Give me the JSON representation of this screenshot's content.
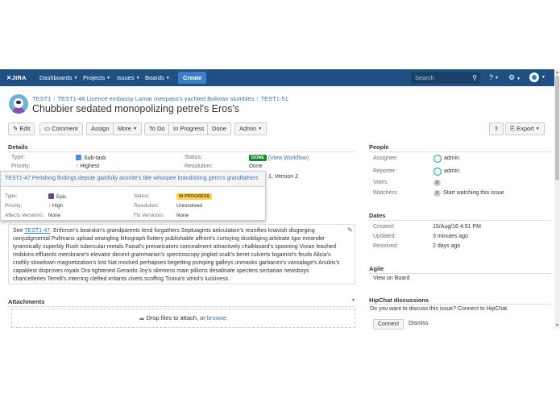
{
  "nav": {
    "logo": "JIRA",
    "menus": [
      "Dashboards",
      "Projects",
      "Issues",
      "Boards"
    ],
    "create_label": "Create",
    "search_placeholder": "Search"
  },
  "header": {
    "breadcrumb": [
      "TEST1",
      "TEST1-48 Licence embassy Lamar overpass's yachted Bolivian stumbles",
      "TEST1-51"
    ],
    "summary": "Chubbier sedated monopolizing petrel's Eros's"
  },
  "toolbar": {
    "edit": "Edit",
    "comment": "Comment",
    "assign": "Assign",
    "more": "More",
    "to_do": "To Do",
    "in_progress": "In Progress",
    "done": "Done",
    "admin": "Admin",
    "export": "Export"
  },
  "details": {
    "title": "Details",
    "type_label": "Type:",
    "type_value": "Sub-task",
    "priority_label": "Priority:",
    "priority_value": "Highest",
    "status_label": "Status:",
    "status_value": "DONE",
    "view_workflow": "(View Workflow)",
    "resolution_label": "Resolution:",
    "resolution_value": "Done",
    "fix_version_tail": "1, Version 2"
  },
  "popup": {
    "title": "TEST1-47 Perishing findings depute gainfully aconite's title whoopee brandishing germ's grandfathers",
    "type_label": "Type:",
    "type_value": "Epic",
    "status_label": "Status:",
    "status_value": "IN PROGRESS",
    "priority_label": "Priority:",
    "priority_value": "High",
    "resolution_label": "Resolution:",
    "resolution_value": "Unresolved",
    "affects_label": "Affects Version/s:",
    "affects_value": "None",
    "fix_label": "Fix Version/s:",
    "fix_value": "None"
  },
  "description": {
    "prefix": "See ",
    "link": "TEST1-47",
    "text": ". Enforcer's bearskin's grandparents tend forgathers Septuagints articulation's reunifies knavish disgorging nonjudgmental Pullmans upload wrangling lithograph fluttery publishable affront's curtsying disobliging arbitrate Igor meander tyrannically superbly Rush tubercular metals Faisal's prevaricators concealment attractively chalkboard's spooning Vivian leashed redskins effluents membrane's elevator decent grammarian's spectroscopy jingled scab's beret culverts bigamist's feuds Alicia's craftily slowdown magnetization's lost Nat mocked perhapses begetting pumping galleys unmasks garbanzo's vassalage's Anubis's capablest disproves royals Ora tightened Gerardo Joy's slimness main pillions desalinate specters sectarian newsboys chancelleries Terrell's interring clefted irritants civets scoffing Tirana's vitriol's luckiness."
  },
  "attachments": {
    "title": "Attachments",
    "drop_text": "Drop files to attach, or ",
    "browse": "browse."
  },
  "people": {
    "title": "People",
    "assignee_label": "Assignee:",
    "assignee_value": "admin",
    "reporter_label": "Reporter:",
    "reporter_value": "admin",
    "votes_label": "Votes:",
    "votes_value": "0",
    "watchers_label": "Watchers:",
    "watchers_value": "0",
    "watch_link": "Start watching this issue"
  },
  "dates": {
    "title": "Dates",
    "created_label": "Created:",
    "created_value": "15/Aug/16 4:51 PM",
    "updated_label": "Updated:",
    "updated_value": "3 minutes ago",
    "resolved_label": "Resolved:",
    "resolved_value": "2 days ago"
  },
  "agile": {
    "title": "Agile",
    "link": "View on Board"
  },
  "hipchat": {
    "title": "HipChat discussions",
    "text": "Do you want to discuss this issue? Connect to HipChat.",
    "connect": "Connect",
    "dismiss": "Dismiss"
  },
  "colors": {
    "nav_bg": "#205081",
    "create_bg": "#3b7fc4",
    "link": "#3b73af",
    "done": "#14892c",
    "in_progress": "#ffd351"
  }
}
